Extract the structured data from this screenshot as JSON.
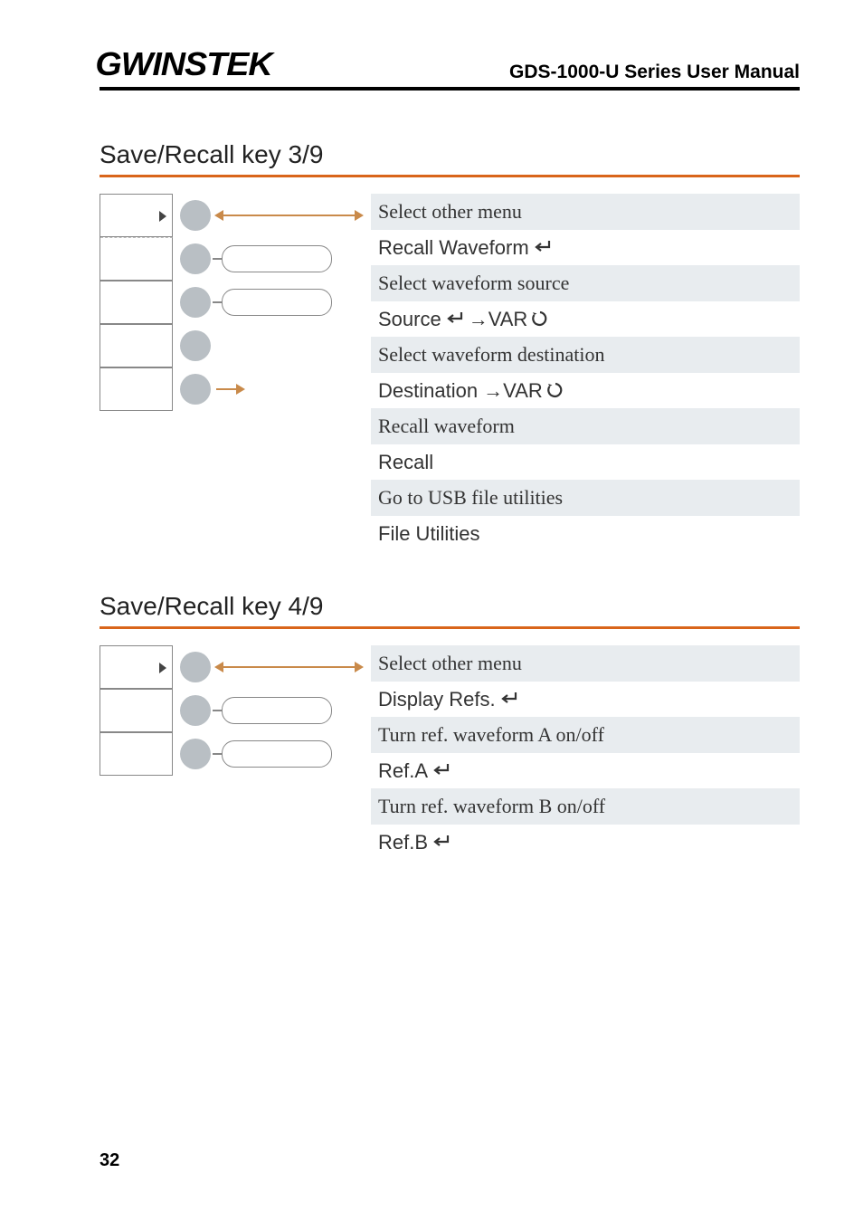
{
  "header": {
    "logo": "GWINSTEK",
    "title": "GDS-1000-U Series User Manual"
  },
  "page_number": "32",
  "sections": [
    {
      "title": "Save/Recall key 3/9",
      "diagram_rows": 5,
      "items": [
        {
          "desc": "Select other menu",
          "ctrl_parts": [
            {
              "t": "text",
              "v": "Recall Waveform"
            },
            {
              "t": "enter"
            }
          ]
        },
        {
          "desc": "Select waveform source",
          "ctrl_parts": [
            {
              "t": "text",
              "v": "Source"
            },
            {
              "t": "enter"
            },
            {
              "t": "text",
              "v": "→VAR"
            },
            {
              "t": "var"
            }
          ]
        },
        {
          "desc": "Select waveform destination",
          "ctrl_parts": [
            {
              "t": "text",
              "v": "Destination →VAR"
            },
            {
              "t": "var"
            }
          ]
        },
        {
          "desc": "Recall waveform",
          "ctrl_parts": [
            {
              "t": "text",
              "v": "Recall"
            }
          ]
        },
        {
          "desc": "Go to USB file utilities",
          "ctrl_parts": [
            {
              "t": "text",
              "v": "File Utilities"
            }
          ]
        }
      ]
    },
    {
      "title": "Save/Recall key 4/9",
      "diagram_rows": 3,
      "items": [
        {
          "desc": "Select other menu",
          "ctrl_parts": [
            {
              "t": "text",
              "v": "Display Refs."
            },
            {
              "t": "enter"
            }
          ]
        },
        {
          "desc": "Turn ref. waveform A on/off",
          "ctrl_parts": [
            {
              "t": "text",
              "v": "Ref.A"
            },
            {
              "t": "enter"
            }
          ]
        },
        {
          "desc": "Turn ref. waveform B on/off",
          "ctrl_parts": [
            {
              "t": "text",
              "v": "Ref.B"
            },
            {
              "t": "enter"
            }
          ]
        }
      ]
    }
  ]
}
